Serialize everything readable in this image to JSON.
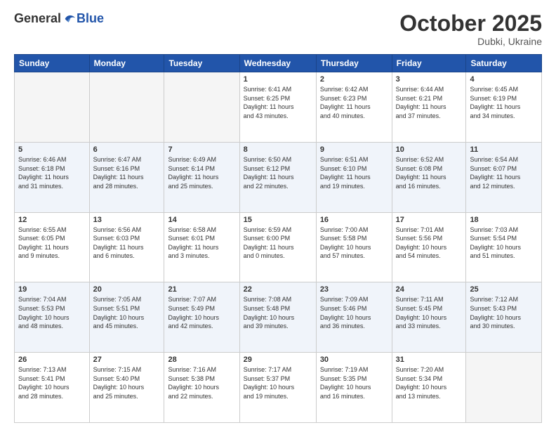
{
  "logo": {
    "general": "General",
    "blue": "Blue"
  },
  "header": {
    "month": "October 2025",
    "location": "Dubki, Ukraine"
  },
  "weekdays": [
    "Sunday",
    "Monday",
    "Tuesday",
    "Wednesday",
    "Thursday",
    "Friday",
    "Saturday"
  ],
  "weeks": [
    {
      "shaded": false,
      "days": [
        {
          "day": "",
          "info": ""
        },
        {
          "day": "",
          "info": ""
        },
        {
          "day": "",
          "info": ""
        },
        {
          "day": "1",
          "info": "Sunrise: 6:41 AM\nSunset: 6:25 PM\nDaylight: 11 hours\nand 43 minutes."
        },
        {
          "day": "2",
          "info": "Sunrise: 6:42 AM\nSunset: 6:23 PM\nDaylight: 11 hours\nand 40 minutes."
        },
        {
          "day": "3",
          "info": "Sunrise: 6:44 AM\nSunset: 6:21 PM\nDaylight: 11 hours\nand 37 minutes."
        },
        {
          "day": "4",
          "info": "Sunrise: 6:45 AM\nSunset: 6:19 PM\nDaylight: 11 hours\nand 34 minutes."
        }
      ]
    },
    {
      "shaded": true,
      "days": [
        {
          "day": "5",
          "info": "Sunrise: 6:46 AM\nSunset: 6:18 PM\nDaylight: 11 hours\nand 31 minutes."
        },
        {
          "day": "6",
          "info": "Sunrise: 6:47 AM\nSunset: 6:16 PM\nDaylight: 11 hours\nand 28 minutes."
        },
        {
          "day": "7",
          "info": "Sunrise: 6:49 AM\nSunset: 6:14 PM\nDaylight: 11 hours\nand 25 minutes."
        },
        {
          "day": "8",
          "info": "Sunrise: 6:50 AM\nSunset: 6:12 PM\nDaylight: 11 hours\nand 22 minutes."
        },
        {
          "day": "9",
          "info": "Sunrise: 6:51 AM\nSunset: 6:10 PM\nDaylight: 11 hours\nand 19 minutes."
        },
        {
          "day": "10",
          "info": "Sunrise: 6:52 AM\nSunset: 6:08 PM\nDaylight: 11 hours\nand 16 minutes."
        },
        {
          "day": "11",
          "info": "Sunrise: 6:54 AM\nSunset: 6:07 PM\nDaylight: 11 hours\nand 12 minutes."
        }
      ]
    },
    {
      "shaded": false,
      "days": [
        {
          "day": "12",
          "info": "Sunrise: 6:55 AM\nSunset: 6:05 PM\nDaylight: 11 hours\nand 9 minutes."
        },
        {
          "day": "13",
          "info": "Sunrise: 6:56 AM\nSunset: 6:03 PM\nDaylight: 11 hours\nand 6 minutes."
        },
        {
          "day": "14",
          "info": "Sunrise: 6:58 AM\nSunset: 6:01 PM\nDaylight: 11 hours\nand 3 minutes."
        },
        {
          "day": "15",
          "info": "Sunrise: 6:59 AM\nSunset: 6:00 PM\nDaylight: 11 hours\nand 0 minutes."
        },
        {
          "day": "16",
          "info": "Sunrise: 7:00 AM\nSunset: 5:58 PM\nDaylight: 10 hours\nand 57 minutes."
        },
        {
          "day": "17",
          "info": "Sunrise: 7:01 AM\nSunset: 5:56 PM\nDaylight: 10 hours\nand 54 minutes."
        },
        {
          "day": "18",
          "info": "Sunrise: 7:03 AM\nSunset: 5:54 PM\nDaylight: 10 hours\nand 51 minutes."
        }
      ]
    },
    {
      "shaded": true,
      "days": [
        {
          "day": "19",
          "info": "Sunrise: 7:04 AM\nSunset: 5:53 PM\nDaylight: 10 hours\nand 48 minutes."
        },
        {
          "day": "20",
          "info": "Sunrise: 7:05 AM\nSunset: 5:51 PM\nDaylight: 10 hours\nand 45 minutes."
        },
        {
          "day": "21",
          "info": "Sunrise: 7:07 AM\nSunset: 5:49 PM\nDaylight: 10 hours\nand 42 minutes."
        },
        {
          "day": "22",
          "info": "Sunrise: 7:08 AM\nSunset: 5:48 PM\nDaylight: 10 hours\nand 39 minutes."
        },
        {
          "day": "23",
          "info": "Sunrise: 7:09 AM\nSunset: 5:46 PM\nDaylight: 10 hours\nand 36 minutes."
        },
        {
          "day": "24",
          "info": "Sunrise: 7:11 AM\nSunset: 5:45 PM\nDaylight: 10 hours\nand 33 minutes."
        },
        {
          "day": "25",
          "info": "Sunrise: 7:12 AM\nSunset: 5:43 PM\nDaylight: 10 hours\nand 30 minutes."
        }
      ]
    },
    {
      "shaded": false,
      "days": [
        {
          "day": "26",
          "info": "Sunrise: 7:13 AM\nSunset: 5:41 PM\nDaylight: 10 hours\nand 28 minutes."
        },
        {
          "day": "27",
          "info": "Sunrise: 7:15 AM\nSunset: 5:40 PM\nDaylight: 10 hours\nand 25 minutes."
        },
        {
          "day": "28",
          "info": "Sunrise: 7:16 AM\nSunset: 5:38 PM\nDaylight: 10 hours\nand 22 minutes."
        },
        {
          "day": "29",
          "info": "Sunrise: 7:17 AM\nSunset: 5:37 PM\nDaylight: 10 hours\nand 19 minutes."
        },
        {
          "day": "30",
          "info": "Sunrise: 7:19 AM\nSunset: 5:35 PM\nDaylight: 10 hours\nand 16 minutes."
        },
        {
          "day": "31",
          "info": "Sunrise: 7:20 AM\nSunset: 5:34 PM\nDaylight: 10 hours\nand 13 minutes."
        },
        {
          "day": "",
          "info": ""
        }
      ]
    }
  ]
}
